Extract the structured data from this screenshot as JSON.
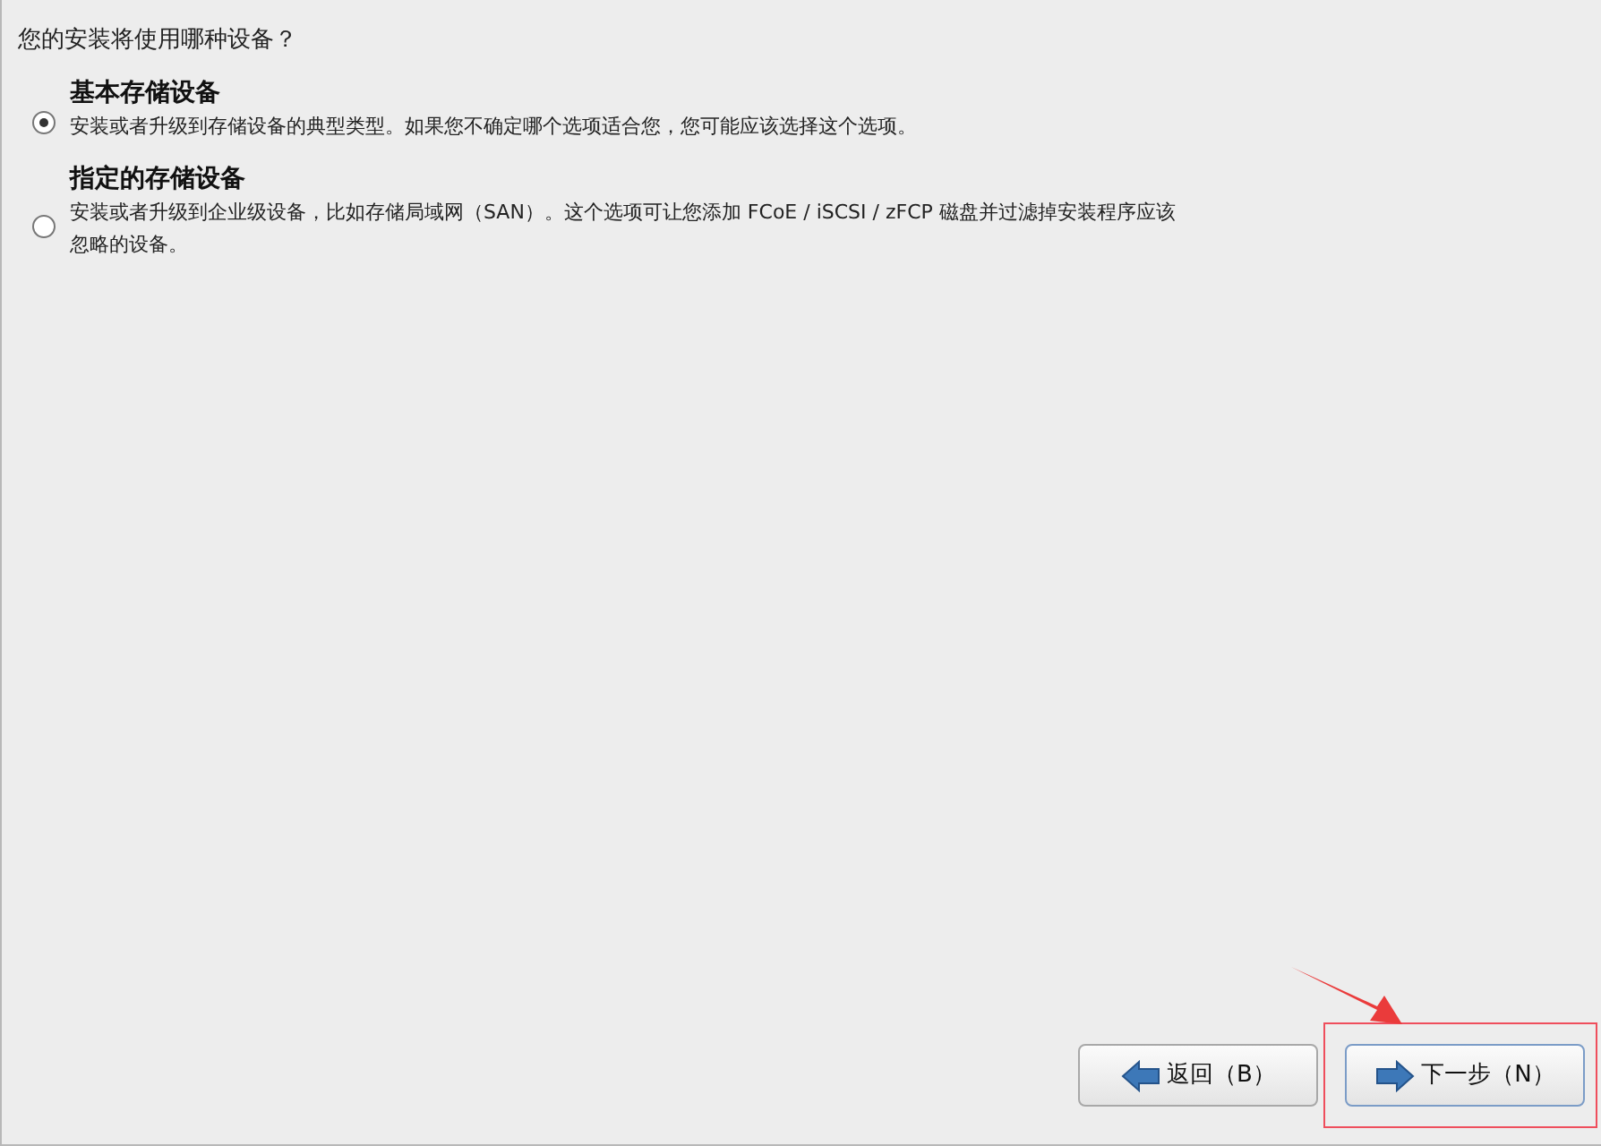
{
  "question": "您的安装将使用哪种设备？",
  "options": [
    {
      "title": "基本存储设备",
      "description": "安装或者升级到存储设备的典型类型。如果您不确定哪个选项适合您，您可能应该选择这个选项。",
      "selected": true
    },
    {
      "title": "指定的存储设备",
      "description": "安装或者升级到企业级设备，比如存储局域网（SAN）。这个选项可让您添加 FCoE / iSCSI / zFCP 磁盘并过滤掉安装程序应该忽略的设备。",
      "selected": false
    }
  ],
  "buttons": [
    {
      "label": "返回（B）",
      "kind": "back",
      "focused": false,
      "highlighted": false
    },
    {
      "label": "下一步（N）",
      "kind": "next",
      "focused": true,
      "highlighted": true
    }
  ]
}
